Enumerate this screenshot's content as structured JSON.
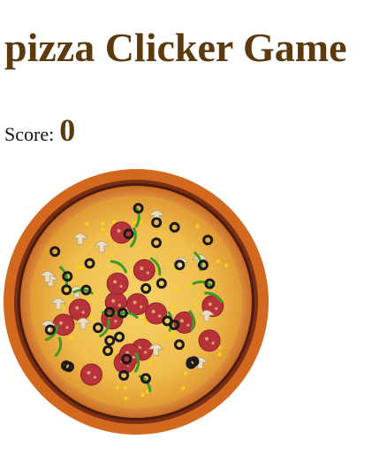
{
  "game": {
    "title": "pizza Clicker Game",
    "score_label": "Score:",
    "score_value": "0"
  },
  "pizza": {
    "icon": "pizza-icon",
    "colors": {
      "heading": "#5c3a0e",
      "pan": "#d2691e",
      "pan_rim": "#6b2a12",
      "crust": "#d7863a",
      "sauce": "#e9a33b",
      "cheese": "#f2c95a",
      "pepperoni": "#b8323a",
      "olive": "#1a1a1a",
      "pepper": "#3f9a2a",
      "mushroom": "#e9dcc0",
      "corn": "#f5d21a"
    }
  }
}
